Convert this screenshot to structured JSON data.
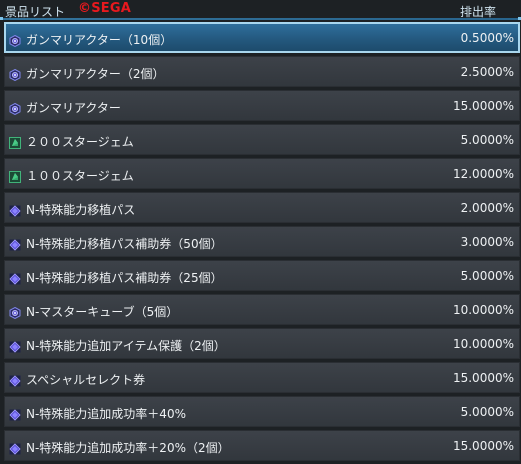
{
  "header": {
    "title": "景品リスト",
    "logo": "©SEGA",
    "rate_column": "排出率"
  },
  "colors": {
    "accent": "#2f6f9c",
    "selected_border": "#a9d7ee",
    "row_bg": "#3a3f45",
    "logo_red": "#e8191e"
  },
  "items": [
    {
      "name": "ガンマリアクター（10個）",
      "rate": "0.5000%",
      "icon": "reactor-icon",
      "selected": true
    },
    {
      "name": "ガンマリアクター（2個）",
      "rate": "2.5000%",
      "icon": "reactor-icon",
      "selected": false
    },
    {
      "name": "ガンマリアクター",
      "rate": "15.0000%",
      "icon": "reactor-icon",
      "selected": false
    },
    {
      "name": "２００スタージェム",
      "rate": "5.0000%",
      "icon": "stargem-icon",
      "selected": false
    },
    {
      "name": "１００スタージェム",
      "rate": "12.0000%",
      "icon": "stargem-icon",
      "selected": false
    },
    {
      "name": "N-特殊能力移植パス",
      "rate": "2.0000%",
      "icon": "diamond-item-icon",
      "selected": false
    },
    {
      "name": "N-特殊能力移植パス補助券（50個）",
      "rate": "3.0000%",
      "icon": "diamond-item-icon",
      "selected": false
    },
    {
      "name": "N-特殊能力移植パス補助券（25個）",
      "rate": "5.0000%",
      "icon": "diamond-item-icon",
      "selected": false
    },
    {
      "name": "N-マスターキューブ（5個）",
      "rate": "10.0000%",
      "icon": "reactor-icon",
      "selected": false
    },
    {
      "name": "N-特殊能力追加アイテム保護（2個）",
      "rate": "10.0000%",
      "icon": "diamond-item-icon",
      "selected": false
    },
    {
      "name": "スペシャルセレクト券",
      "rate": "15.0000%",
      "icon": "diamond-item-icon",
      "selected": false
    },
    {
      "name": "N-特殊能力追加成功率＋40%",
      "rate": "5.0000%",
      "icon": "diamond-item-icon",
      "selected": false
    },
    {
      "name": "N-特殊能力追加成功率＋20%（2個）",
      "rate": "15.0000%",
      "icon": "diamond-item-icon",
      "selected": false
    }
  ]
}
